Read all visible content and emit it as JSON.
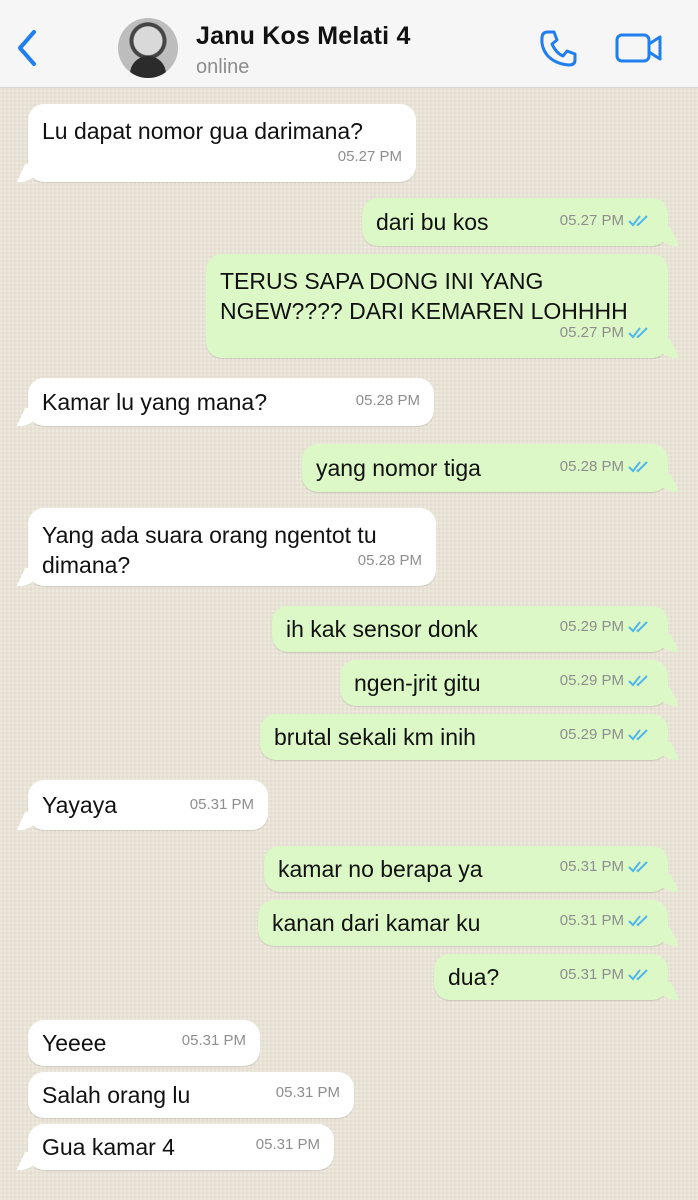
{
  "header": {
    "contact_name": "Janu Kos Melati 4",
    "status": "online",
    "icons": [
      "chevron-left-icon",
      "phone-icon",
      "video-camera-icon"
    ],
    "accent_color": "#1f7ef0"
  },
  "messages": [
    {
      "dir": "in",
      "text": "Lu dapat nomor gua darimana?",
      "time": "05.27 PM"
    },
    {
      "dir": "out",
      "text": "dari bu kos",
      "time": "05.27 PM"
    },
    {
      "dir": "out",
      "text": "TERUS SAPA DONG INI YANG NGEW???? DARI KEMAREN LOHHHH",
      "time": "05.27 PM"
    },
    {
      "dir": "in",
      "text": "Kamar lu yang mana?",
      "time": "05.28 PM"
    },
    {
      "dir": "out",
      "text": "yang nomor tiga",
      "time": "05.28 PM"
    },
    {
      "dir": "in",
      "text": "Yang ada suara orang ngentot tu dimana?",
      "time": "05.28 PM"
    },
    {
      "dir": "out",
      "text": "ih kak sensor donk",
      "time": "05.29 PM"
    },
    {
      "dir": "out",
      "text": "ngen-jrit gitu",
      "time": "05.29 PM"
    },
    {
      "dir": "out",
      "text": "brutal sekali km inih",
      "time": "05.29 PM"
    },
    {
      "dir": "in",
      "text": "Yayaya",
      "time": "05.31 PM"
    },
    {
      "dir": "out",
      "text": "kamar no berapa ya",
      "time": "05.31 PM"
    },
    {
      "dir": "out",
      "text": "kanan dari kamar ku",
      "time": "05.31 PM"
    },
    {
      "dir": "out",
      "text": "dua?",
      "time": "05.31 PM"
    },
    {
      "dir": "in",
      "text": "Yeeee",
      "time": "05.31 PM"
    },
    {
      "dir": "in",
      "text": "Salah orang lu",
      "time": "05.31 PM"
    },
    {
      "dir": "in",
      "text": "Gua kamar 4",
      "time": "05.31 PM"
    }
  ],
  "colors": {
    "incoming_bubble": "#ffffff",
    "outgoing_bubble": "#dcf8c6",
    "read_ticks": "#4fb6ec",
    "wallpaper": "#ece6d9"
  }
}
